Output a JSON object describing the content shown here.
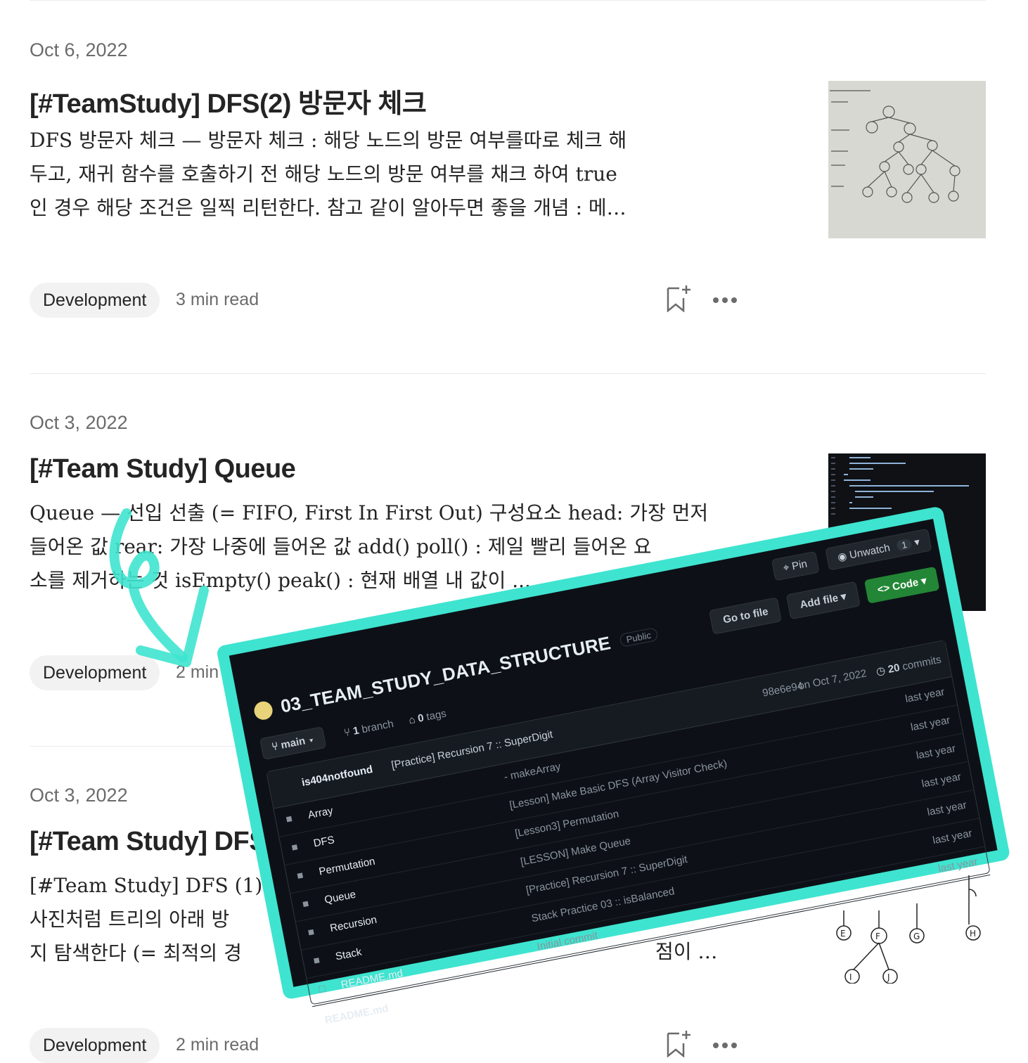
{
  "posts": [
    {
      "date": "Oct 6, 2022",
      "title": "[#TeamStudy] DFS(2) 방문자 체크",
      "excerpt": [
        "DFS 방문자 체크 — 방문자 체크 : 해당 노드의 방문 여부를따로 체크 해",
        "두고, 재귀 함수를 호출하기 전 해당 노드의 방문 여부를 채크 하여 true",
        "인 경우 해당 조건은 일찍 리턴한다. 참고 같이 알아두면 좋을 개념 : 메…"
      ],
      "tag": "Development",
      "read_time": "3 min read"
    },
    {
      "date": "Oct 3, 2022",
      "title": "[#Team Study] Queue",
      "excerpt": [
        "Queue — 선입 선출 (= FIFO, First In First Out) 구성요소 head: 가장 먼저",
        "들어온 값 rear: 가장 나중에 들어온 값 add() poll() : 제일 빨리 들어온 요",
        "소를 제거하는 것 isEmpty() peak() : 현재 배열 내 값이 ..."
      ],
      "tag": "Development",
      "read_time": "2 min read"
    },
    {
      "date": "Oct 3, 2022",
      "title": "[#Team Study] DFS",
      "excerpt": [
        "[#Team Study] DFS (1) 깊",
        "사진처럼 트리의 아래 방",
        "지 탐색한다 (= 최적의 경"
      ],
      "excerpt_tail": "점이 …",
      "tag": "Development",
      "read_time": "2 min read"
    }
  ],
  "overlay": {
    "repo_name": "03_TEAM_STUDY_DATA_STRUCTURE",
    "visibility": "Public",
    "pin_label": "Pin",
    "unwatch_label": "Unwatch",
    "unwatch_count": "1",
    "branch_label": "main",
    "branches": "1",
    "branches_word": "branch",
    "tags": "0",
    "tags_word": "tags",
    "go_to_file": "Go to file",
    "add_file": "Add file",
    "code_label": "Code",
    "last_commit_author": "is404notfound",
    "last_commit_message": "[Practice] Recursion 7 :: SuperDigit",
    "last_commit_hash": "98e6e94",
    "last_commit_date": "on Oct 7, 2022",
    "commits_count": "20",
    "commits_word": "commits",
    "files": [
      {
        "name": "Array",
        "message": "- makeArray",
        "time": "last year",
        "type": "dir"
      },
      {
        "name": "DFS",
        "message": "[Lesson] Make Basic DFS (Array Visitor Check)",
        "time": "last year",
        "type": "dir"
      },
      {
        "name": "Permutation",
        "message": "[Lesson3] Permutation",
        "time": "last year",
        "type": "dir"
      },
      {
        "name": "Queue",
        "message": "[LESSON] Make Queue",
        "time": "last year",
        "type": "dir"
      },
      {
        "name": "Recursion",
        "message": "[Practice] Recursion 7 :: SuperDigit",
        "time": "last year",
        "type": "dir"
      },
      {
        "name": "Stack",
        "message": "Stack Practice 03 :: isBalanced",
        "time": "last year",
        "type": "dir"
      },
      {
        "name": "README.md",
        "message": "Initial commit",
        "time": "last year",
        "type": "file"
      }
    ],
    "extra_time": "last year",
    "readme_stub": "README.md"
  },
  "colors": {
    "accent_overlay_border": "#3ee4cf",
    "code_button": "#238636",
    "dark_bg": "#0d1117"
  }
}
